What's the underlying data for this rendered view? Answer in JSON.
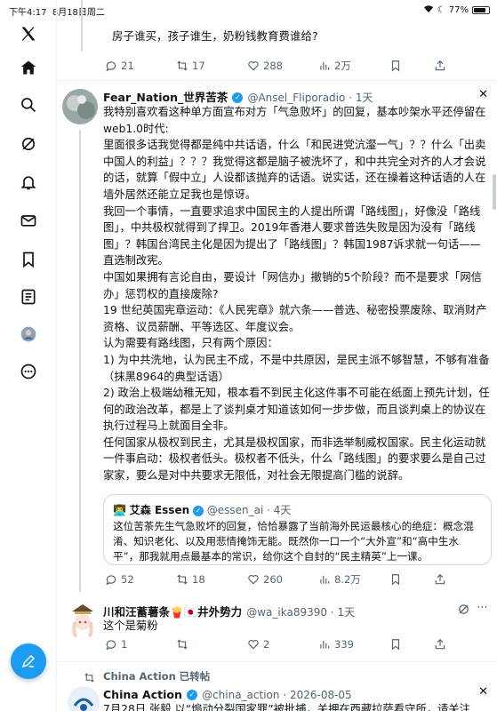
{
  "status_bar": {
    "time": "下午4:17",
    "date": "8月18日周二",
    "battery": "77%"
  },
  "sidebar": {
    "items": [
      {
        "name": "x-logo-icon"
      },
      {
        "name": "home-icon"
      },
      {
        "name": "search-icon"
      },
      {
        "name": "grok-icon"
      },
      {
        "name": "bell-icon"
      },
      {
        "name": "mail-icon"
      },
      {
        "name": "bookmark-icon"
      },
      {
        "name": "list-icon"
      },
      {
        "name": "profile-icon"
      },
      {
        "name": "more-icon"
      }
    ]
  },
  "tweet0": {
    "text": "房子谁买，孩子谁生，奶粉钱教育费谁给?",
    "replies": "21",
    "retweets": "17",
    "likes": "288",
    "views": "2万"
  },
  "tweet1": {
    "display_name": "Fear_Nation_世界苦茶",
    "handle": "@Ansel_Fliporadio",
    "time": "1天",
    "paragraphs": [
      "我特别喜欢看这种单方面宣布对方「气急败坏」的回复，基本吵架水平还停留在web1.0时代:",
      "里面很多话我觉得都是纯中共话语，什么「和民进党沆瀣一气」？？什么「出卖中国人的利益」？？？我觉得这都是脑子被洗坏了，和中共完全对齐的人才会说的话，就算「假中立」人设都该抛弃的话语。说实话，还在操着这种话语的人在墙外居然还能立足我也是惊讶。",
      "我回一个事情，一直要求追求中国民主的人提出所谓「路线图」，好像没「路线图」，中共极权就得到了捍卫。2019年香港人要求普选失败是因为没有「路线图」？韩国台湾民主化是因为提出了「路线图」？韩国1987诉求就一句话——直选制改宪。",
      "中国如果拥有言论自由，要设计「网信办」撤销的5个阶段？而不是要求「网信办」惩罚权的直接废除?",
      "19 世纪英国宪章运动：《人民宪章》就六条——普选、秘密投票废除、取消财产资格、议员薪酬、平等选区、年度议会。",
      "认为需要有路线图，只有两个原因：",
      "1) 为中共洗地，认为民主不成，不是中共原因，是民主派不够智慧，不够有准备（抹黑8964的典型话语）",
      "2) 政治上极端幼稚无知，根本看不到民主化这件事不可能在纸面上预先计划，任何的政治改革，都是上了谈判桌才知道该如何一步步做，而且谈判桌上的协议在执行过程马上就面目全非。",
      "任何国家从极权到民主，尤其是极权国家，而非选举制威权国家。民主化运动就一件事启动：极权者低头。极权者不低头，什么「路线图」的要求要么是自己过家家，要么是对中共要求无限低，对社会无限提高门槛的说辞。"
    ],
    "quote": {
      "display_name": "艾森 Essen",
      "handle": "@essen_ai",
      "time": "4天",
      "text": "这位苦茶先生气急败坏的回复，恰恰暴露了当前海外民运最核心的绝症：概念混淆、知识老化、以及用悲情掩饰无能。既然你一口一个“大外宣”和“高中生水平”，那我就用点最基本的常识，给你这个自封的“民主精英”上一课。"
    },
    "replies": "52",
    "retweets": "18",
    "likes": "260",
    "views": "8.2万"
  },
  "tweet2": {
    "display_name": "川和汪蓄薯条🍟🇯🇵井外势力",
    "handle": "@wa_ika89390",
    "time": "1天",
    "text": "这个是菊粉",
    "replies": "1",
    "retweets": "",
    "likes": "2",
    "views": "339"
  },
  "tweet3": {
    "repost_label": "China Action 已转帖",
    "display_name": "China Action",
    "handle": "@china_action",
    "time": "2026-08-05",
    "text": "7月28日 张毅 以“煽动分裂国家罪”被批捕，关押在西藏拉萨看守所，请关注"
  },
  "colors": {
    "accent": "#1d9bf0",
    "muted": "#536471",
    "border": "#cfd9de"
  }
}
